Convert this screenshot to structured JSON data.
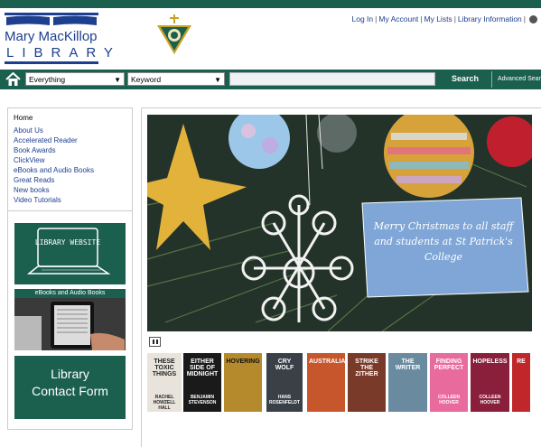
{
  "header": {
    "logo_title": "Mary MacKillop",
    "logo_subtitle": "LIBRARY",
    "links": [
      "Log In",
      "My Account",
      "My Lists",
      "Library Information"
    ]
  },
  "search": {
    "scope": "Everything",
    "field": "Keyword",
    "query": "",
    "button": "Search",
    "advanced": "Advanced Search"
  },
  "sidebar": {
    "heading": "Home",
    "links": [
      "About Us",
      "Accelerated Reader",
      "Book Awards",
      "ClickView",
      "eBooks and Audio Books",
      "Great Reads",
      "New books",
      "Video Tutorials"
    ],
    "tiles": {
      "library_website": "LIBRARY WEBSITE",
      "ebooks": "eBooks and Audio Books",
      "contact_line1": "Library",
      "contact_line2": "Contact Form"
    }
  },
  "banner": {
    "caption": "Merry Christmas to all staff and students at St Patrick's College"
  },
  "books": [
    {
      "title": "THESE TOXIC THINGS",
      "author": "RACHEL HOWZELL HALL",
      "color": "#e8e4dc",
      "text": "#222"
    },
    {
      "title": "EITHER SIDE OF MIDNIGHT",
      "author": "BENJAMIN STEVENSON",
      "color": "#1a1a1a",
      "text": "#fff"
    },
    {
      "title": "HOVERING",
      "author": "",
      "color": "#b58a2c",
      "text": "#111"
    },
    {
      "title": "CRY WOLF",
      "author": "HANS ROSENFELDT",
      "color": "#3a4048",
      "text": "#fff"
    },
    {
      "title": "AUSTRALIANA",
      "author": "",
      "color": "#c8562c",
      "text": "#fff"
    },
    {
      "title": "STRIKE THE ZITHER",
      "author": "",
      "color": "#7a3a2a",
      "text": "#fff"
    },
    {
      "title": "THE WRITER",
      "author": "",
      "color": "#6a8aa0",
      "text": "#fff"
    },
    {
      "title": "FINDING PERFECT",
      "author": "COLLEEN HOOVER",
      "color": "#e96a9c",
      "text": "#fff"
    },
    {
      "title": "HOPELESS",
      "author": "COLLEEN HOOVER",
      "color": "#8a1f3c",
      "text": "#fff"
    },
    {
      "title": "RE",
      "author": "",
      "color": "#c0262a",
      "text": "#fff"
    }
  ],
  "colors": {
    "brand_green": "#1b5f4f",
    "brand_blue": "#1d3f8f",
    "caption_blue": "#7fa6d6"
  }
}
